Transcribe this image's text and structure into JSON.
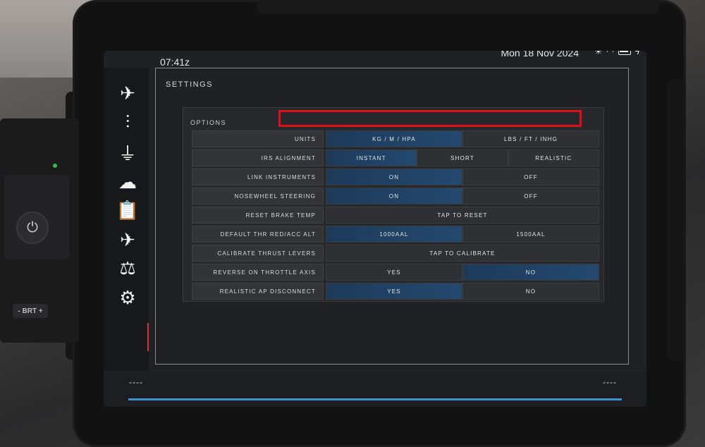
{
  "status_bar": {
    "time": "07:41z",
    "date": "Mon 18 Nov 2024"
  },
  "bezel": {
    "brt_label": "- BRT +"
  },
  "sidebar": {
    "items": [
      {
        "name": "flight-icon",
        "glyph": "✈"
      },
      {
        "name": "sliders-icon",
        "glyph": "⫶"
      },
      {
        "name": "plug-icon",
        "glyph": "⏚"
      },
      {
        "name": "cloud-icon",
        "glyph": "☁"
      },
      {
        "name": "clipboard-icon",
        "glyph": "📋"
      },
      {
        "name": "aircraft-icon",
        "glyph": "✈"
      },
      {
        "name": "balance-icon",
        "glyph": "⚖"
      },
      {
        "name": "gear-icon",
        "glyph": "⚙"
      }
    ],
    "active": "gear-icon"
  },
  "settings": {
    "title": "SETTINGS",
    "options_title": "OPTIONS",
    "rows": [
      {
        "label": "UNITS",
        "options": [
          "KG / M / HPA",
          "LBS / FT / INHG"
        ],
        "selected": 0
      },
      {
        "label": "IRS ALIGNMENT",
        "options": [
          "INSTANT",
          "SHORT",
          "REALISTIC"
        ],
        "selected": 0
      },
      {
        "label": "LINK INSTRUMENTS",
        "options": [
          "ON",
          "OFF"
        ],
        "selected": 0
      },
      {
        "label": "NOSEWHEEL STEERING",
        "options": [
          "ON",
          "OFF"
        ],
        "selected": 0
      },
      {
        "label": "RESET BRAKE TEMP",
        "options": [
          "TAP TO RESET"
        ],
        "selected": -1
      },
      {
        "label": "DEFAULT THR RED/ACC ALT",
        "options": [
          "1000AAL",
          "1500AAL"
        ],
        "selected": 0
      },
      {
        "label": "CALIBRATE THRUST LEVERS",
        "options": [
          "TAP TO CALIBRATE"
        ],
        "selected": -1
      },
      {
        "label": "REVERSE ON THROTTLE AXIS",
        "options": [
          "YES",
          "NO"
        ],
        "selected": 1
      },
      {
        "label": "REALISTIC AP DISCONNECT",
        "options": [
          "YES",
          "NO"
        ],
        "selected": 0
      }
    ]
  },
  "footer": {
    "left": "----",
    "right": "----",
    "progress": 1.0
  },
  "colors": {
    "selected": "#24496f",
    "highlight": "#e0101a",
    "active_indicator": "#d8343a"
  }
}
